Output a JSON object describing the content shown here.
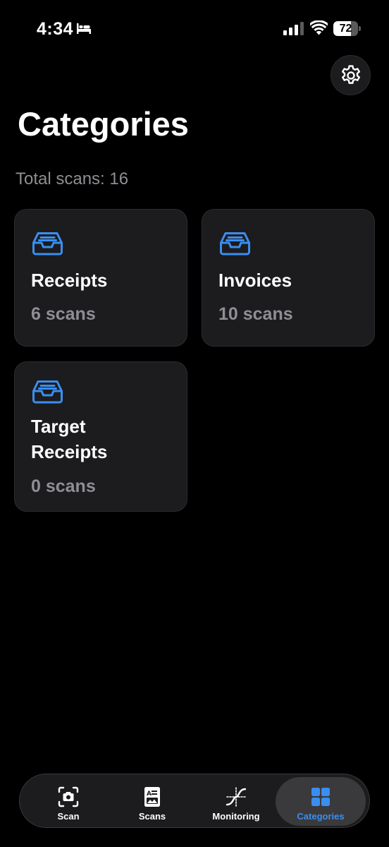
{
  "status_bar": {
    "time": "4:34",
    "battery_level": "72",
    "battery_fraction": 0.72
  },
  "settings": {
    "icon": "gear-icon"
  },
  "page": {
    "title": "Categories",
    "total_scans": "Total scans: 16"
  },
  "categories": [
    {
      "name": "Receipts",
      "count": "6 scans",
      "icon": "tray-icon"
    },
    {
      "name": "Invoices",
      "count": "10 scans",
      "icon": "tray-icon"
    },
    {
      "name": "Target Receipts",
      "count": "0 scans",
      "icon": "tray-icon"
    }
  ],
  "tab_bar": {
    "tabs": [
      {
        "label": "Scan",
        "icon": "camera-viewfinder-icon",
        "active": false
      },
      {
        "label": "Scans",
        "icon": "document-icon",
        "active": false
      },
      {
        "label": "Monitoring",
        "icon": "curve-chart-icon",
        "active": false
      },
      {
        "label": "Categories",
        "icon": "grid-icon",
        "active": true
      }
    ]
  },
  "colors": {
    "background": "#000000",
    "card": "#1c1c1e",
    "accent": "#3a8ef0",
    "secondary_text": "#8e8e93"
  }
}
